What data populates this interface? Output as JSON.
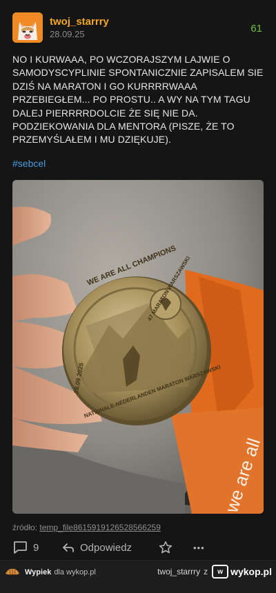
{
  "post": {
    "username": "twoj_starrry",
    "date": "28.09.25",
    "votes": "61",
    "content": "NO I KURWAAA, PO WCZORAJSZYM LAJWIE O SAMODYSCYPLINIE SPONTANICZNIE ZAPISALEM SIE DZIŚ NA MARATON I GO KURRRRWAAA PRZEBIEGŁEM... PO PROSTU.. A WY NA TYM TAGU DALEJ PIERRRRDOLCIE ŻE SIĘ NIE DA. PODZIEKOWANIA DLA MENTORA (PISZE, ŻE TO PRZEMYŚLAŁEM I MU DZIĘKUJE).",
    "tag": "#sebcel",
    "source_label": "źródło:",
    "source_link": "temp_file8615919126528566259"
  },
  "photo": {
    "medal_top_text": "WE ARE ALL CHAMPIONS",
    "medal_badge_text": "47 MARATON WARSZAWSKI",
    "medal_bottom_text": "NATIONALE-NEDERLANDEN MARATON WARSZAWSKI",
    "medal_date": "28.09 2025",
    "ribbon_text": "we are all"
  },
  "actions": {
    "comments_count": "9",
    "reply_label": "Odpowiedz",
    "more_label": "•••"
  },
  "footer": {
    "left_brand": "Wypiek",
    "left_suffix": "dla wykop.pl",
    "right_user": "twoj_starrry",
    "right_z": "z",
    "right_site": "wykop.pl"
  },
  "colors": {
    "accent_username": "#f5a623",
    "votes_green": "#6fbf3a",
    "tag_blue": "#4a9bdc",
    "background": "#151515"
  }
}
